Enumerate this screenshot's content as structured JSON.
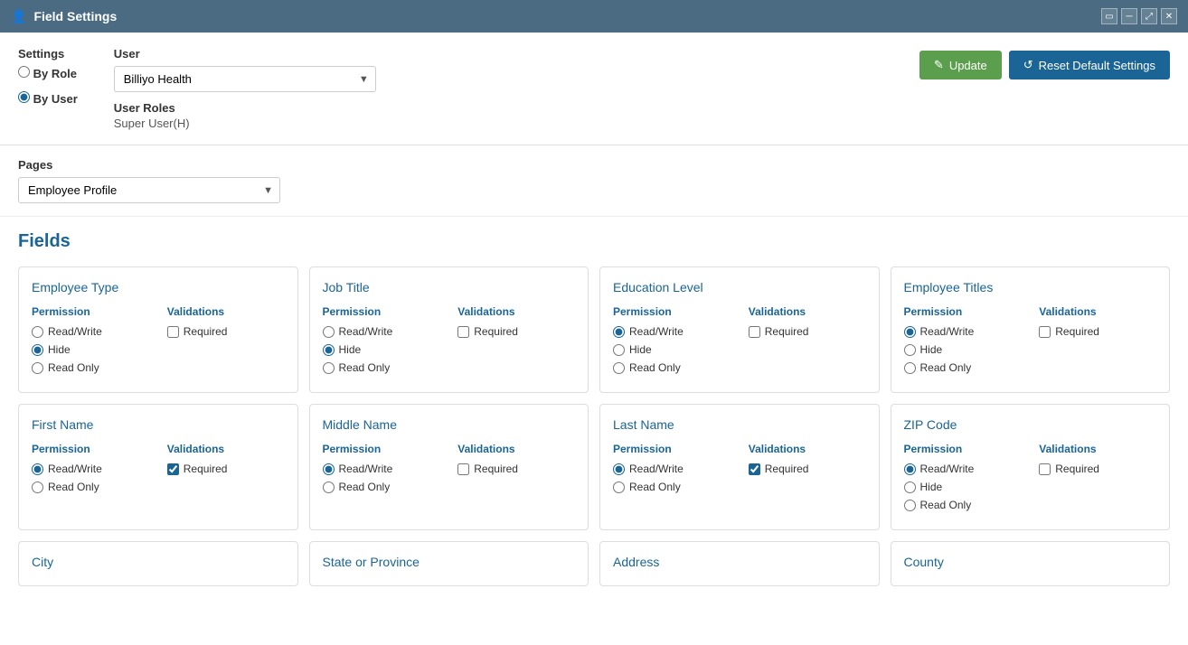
{
  "titleBar": {
    "title": "Field Settings",
    "icon": "👤",
    "controls": [
      "restore",
      "minimize",
      "maximize",
      "close"
    ]
  },
  "settings": {
    "label": "Settings",
    "options": [
      {
        "label": "By Role",
        "value": "byRole",
        "checked": false
      },
      {
        "label": "By User",
        "value": "byUser",
        "checked": true
      }
    ]
  },
  "user": {
    "label": "User",
    "selected": "Billiyo Health",
    "options": [
      "Billiyo Health"
    ],
    "rolesLabel": "User Roles",
    "rolesValue": "Super User(H)"
  },
  "buttons": {
    "update": "Update",
    "reset": "Reset Default Settings"
  },
  "pages": {
    "label": "Pages",
    "selected": "Employee Profile",
    "options": [
      "Employee Profile"
    ]
  },
  "fields": {
    "sectionTitle": "Fields",
    "cards": [
      {
        "title": "Employee Type",
        "permissionLabel": "Permission",
        "validationsLabel": "Validations",
        "permissions": [
          {
            "label": "Read/Write",
            "checked": false
          },
          {
            "label": "Hide",
            "checked": true
          },
          {
            "label": "Read Only",
            "checked": false
          }
        ],
        "required": false
      },
      {
        "title": "Job Title",
        "permissionLabel": "Permission",
        "validationsLabel": "Validations",
        "permissions": [
          {
            "label": "Read/Write",
            "checked": false
          },
          {
            "label": "Hide",
            "checked": true
          },
          {
            "label": "Read Only",
            "checked": false
          }
        ],
        "required": false
      },
      {
        "title": "Education Level",
        "permissionLabel": "Permission",
        "validationsLabel": "Validations",
        "permissions": [
          {
            "label": "Read/Write",
            "checked": true
          },
          {
            "label": "Hide",
            "checked": false
          },
          {
            "label": "Read Only",
            "checked": false
          }
        ],
        "required": false
      },
      {
        "title": "Employee Titles",
        "permissionLabel": "Permission",
        "validationsLabel": "Validations",
        "permissions": [
          {
            "label": "Read/Write",
            "checked": true
          },
          {
            "label": "Hide",
            "checked": false
          },
          {
            "label": "Read Only",
            "checked": false
          }
        ],
        "required": false
      },
      {
        "title": "First Name",
        "permissionLabel": "Permission",
        "validationsLabel": "Validations",
        "permissions": [
          {
            "label": "Read/Write",
            "checked": true
          },
          {
            "label": "Read Only",
            "checked": false
          }
        ],
        "required": true
      },
      {
        "title": "Middle Name",
        "permissionLabel": "Permission",
        "validationsLabel": "Validations",
        "permissions": [
          {
            "label": "Read/Write",
            "checked": true
          },
          {
            "label": "Read Only",
            "checked": false
          }
        ],
        "required": false
      },
      {
        "title": "Last Name",
        "permissionLabel": "Permission",
        "validationsLabel": "Validations",
        "permissions": [
          {
            "label": "Read/Write",
            "checked": true
          },
          {
            "label": "Read Only",
            "checked": false
          }
        ],
        "required": true
      },
      {
        "title": "ZIP Code",
        "permissionLabel": "Permission",
        "validationsLabel": "Validations",
        "permissions": [
          {
            "label": "Read/Write",
            "checked": true
          },
          {
            "label": "Hide",
            "checked": false
          },
          {
            "label": "Read Only",
            "checked": false
          }
        ],
        "required": false
      }
    ],
    "bottomStubs": [
      "City",
      "State or Province",
      "Address",
      "County"
    ]
  }
}
